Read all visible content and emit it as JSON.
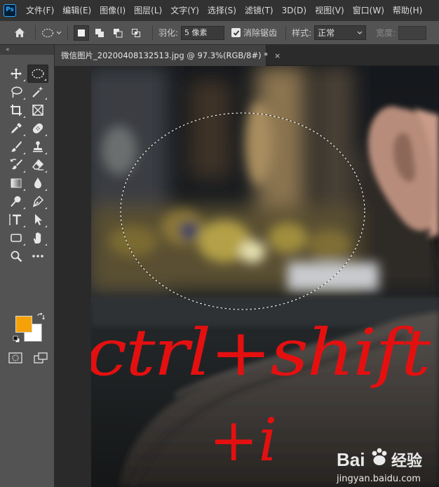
{
  "app": {
    "logo": "Ps",
    "menu": [
      "文件(F)",
      "编辑(E)",
      "图像(I)",
      "图层(L)",
      "文字(Y)",
      "选择(S)",
      "滤镜(T)",
      "3D(D)",
      "视图(V)",
      "窗口(W)",
      "帮助(H)"
    ]
  },
  "options": {
    "feather_label": "羽化:",
    "feather_value": "5 像素",
    "antialias_label": "消除锯齿",
    "antialias_checked": true,
    "style_label": "样式:",
    "style_value": "正常",
    "width_label": "宽度:"
  },
  "toolbox": {
    "collapse_glyph": "«",
    "foreground_color": "#f5a20a",
    "background_color": "#ffffff",
    "tools": [
      "move-tool-icon",
      "elliptical-marquee-tool-icon",
      "lasso-tool-icon",
      "magic-wand-tool-icon",
      "crop-tool-icon",
      "frame-tool-icon",
      "eyedropper-tool-icon",
      "healing-brush-tool-icon",
      "brush-tool-icon",
      "clone-stamp-tool-icon",
      "history-brush-tool-icon",
      "eraser-tool-icon",
      "gradient-tool-icon",
      "blur-tool-icon",
      "dodge-tool-icon",
      "pen-tool-icon",
      "type-tool-icon",
      "path-selection-tool-icon",
      "rectangle-tool-icon",
      "hand-tool-icon",
      "zoom-tool-icon",
      "more-tools-icon"
    ],
    "type_tool_glyph": "T"
  },
  "document": {
    "tab_title": "微信图片_20200408132513.jpg @ 97.3%(RGB/8#) *",
    "tab_close": "×",
    "annotation_line1": "ctrl+shift",
    "annotation_line2": "+i",
    "annotation_color": "#e41010",
    "watermark_brand": "Bai",
    "watermark_suffix": "经验",
    "watermark_url": "jingyan.baidu.com"
  }
}
